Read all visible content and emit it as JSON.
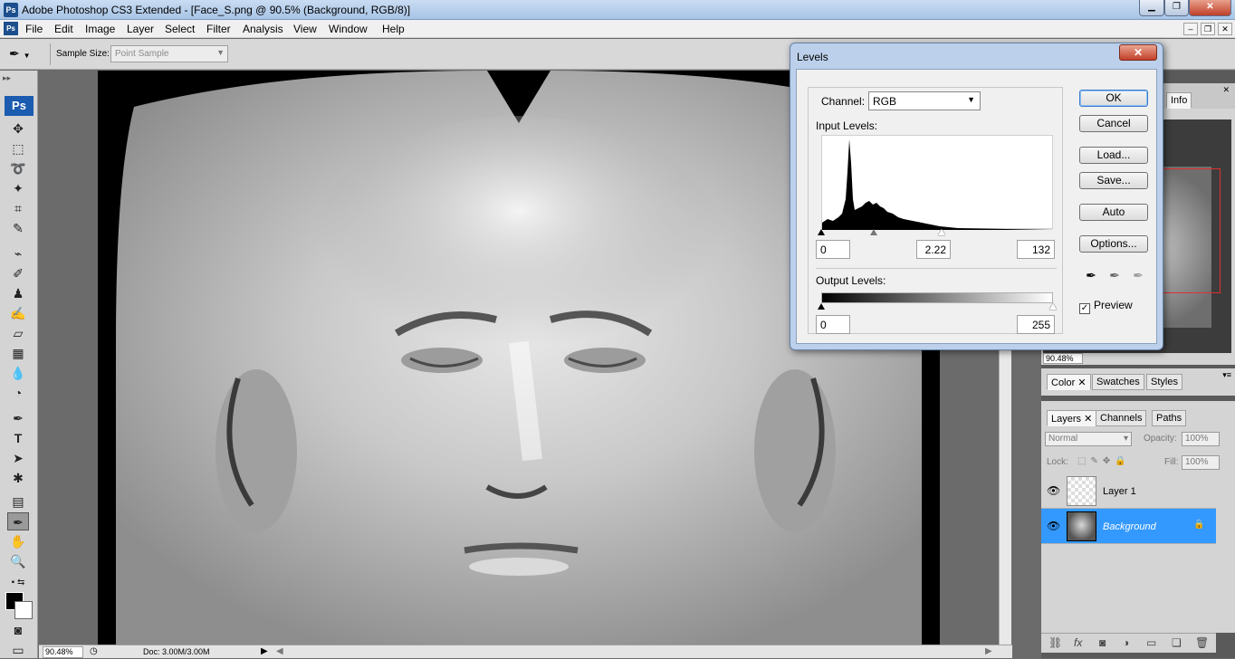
{
  "window": {
    "title": "Adobe Photoshop CS3 Extended - [Face_S.png @ 90.5% (Background, RGB/8)]",
    "ps_badge": "Ps",
    "min": "▁",
    "max": "❐",
    "close": "✕"
  },
  "menu": {
    "items": [
      "File",
      "Edit",
      "Image",
      "Layer",
      "Select",
      "Filter",
      "Analysis",
      "View",
      "Window",
      "Help"
    ]
  },
  "options": {
    "sample_size_label": "Sample Size:",
    "sample_size_value": "Point Sample"
  },
  "toolbox": {
    "logo": "Ps"
  },
  "status": {
    "zoom": "90.48%",
    "doc": "Doc: 3.00M/3.00M"
  },
  "levels": {
    "title": "Levels",
    "channel_label": "Channel:",
    "channel_value": "RGB",
    "input_label": "Input Levels:",
    "input_black": "0",
    "input_gamma": "2.22",
    "input_white": "132",
    "output_label": "Output Levels:",
    "output_black": "0",
    "output_white": "255",
    "buttons": {
      "ok": "OK",
      "cancel": "Cancel",
      "load": "Load...",
      "save": "Save...",
      "auto": "Auto",
      "options": "Options..."
    },
    "preview_label": "Preview",
    "preview_checked": true,
    "gamma_fraction": 0.226,
    "white_fraction": 0.518
  },
  "navigator": {
    "tab_info": "Info",
    "zoom": "90.48%"
  },
  "color_panel": {
    "tabs": [
      "Color",
      "Swatches",
      "Styles"
    ]
  },
  "layers_panel": {
    "tabs": [
      "Layers",
      "Channels",
      "Paths"
    ],
    "blend_mode": "Normal",
    "opacity_label": "Opacity:",
    "opacity": "100%",
    "lock_label": "Lock:",
    "fill_label": "Fill:",
    "fill": "100%",
    "layers": [
      {
        "name": "Layer 1",
        "selected": false
      },
      {
        "name": "Background",
        "selected": true
      }
    ]
  },
  "colors": {
    "selection": "#3399ff",
    "foreground": "#000000",
    "background": "#ffffff"
  }
}
